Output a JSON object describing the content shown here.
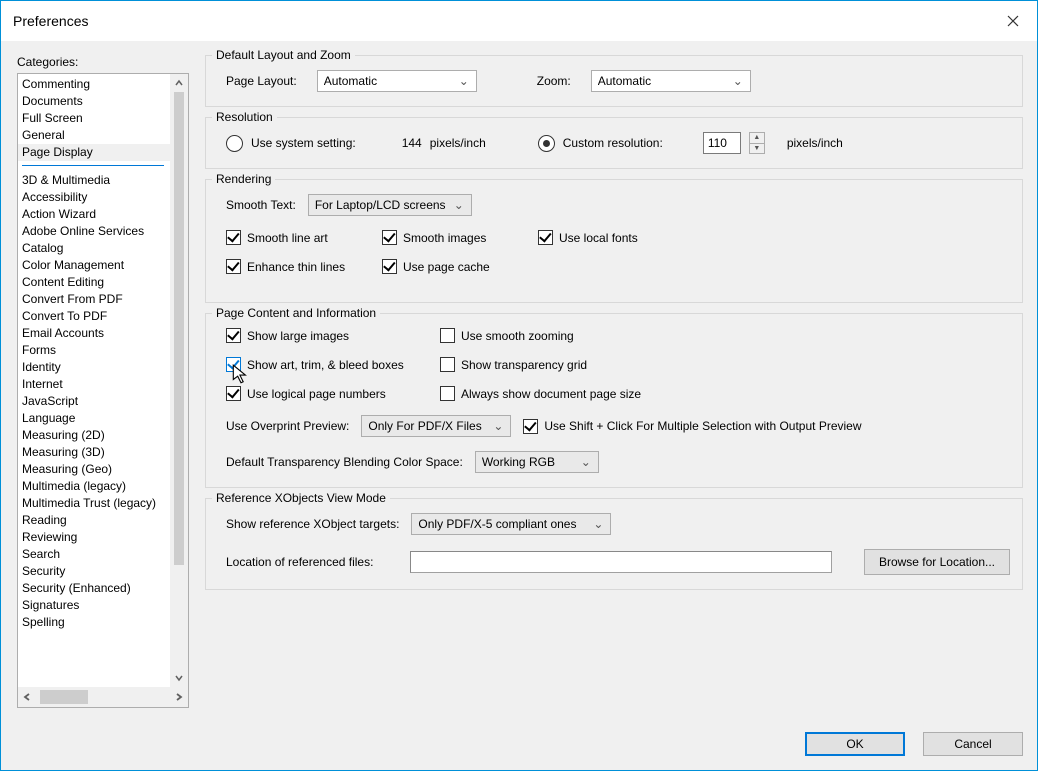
{
  "window": {
    "title": "Preferences"
  },
  "categories": {
    "label": "Categories:",
    "selected": "Page Display",
    "top_items": [
      "Commenting",
      "Documents",
      "Full Screen",
      "General",
      "Page Display"
    ],
    "bottom_items": [
      "3D & Multimedia",
      "Accessibility",
      "Action Wizard",
      "Adobe Online Services",
      "Catalog",
      "Color Management",
      "Content Editing",
      "Convert From PDF",
      "Convert To PDF",
      "Email Accounts",
      "Forms",
      "Identity",
      "Internet",
      "JavaScript",
      "Language",
      "Measuring (2D)",
      "Measuring (3D)",
      "Measuring (Geo)",
      "Multimedia (legacy)",
      "Multimedia Trust (legacy)",
      "Reading",
      "Reviewing",
      "Search",
      "Security",
      "Security (Enhanced)",
      "Signatures",
      "Spelling"
    ]
  },
  "layout_zoom": {
    "group_title": "Default Layout and Zoom",
    "page_layout_label": "Page Layout:",
    "page_layout_value": "Automatic",
    "zoom_label": "Zoom:",
    "zoom_value": "Automatic"
  },
  "resolution": {
    "group_title": "Resolution",
    "use_system_label": "Use system setting:",
    "system_value": "144",
    "system_unit": "pixels/inch",
    "custom_label": "Custom resolution:",
    "custom_value": "110",
    "custom_unit": "pixels/inch",
    "selected": "custom"
  },
  "rendering": {
    "group_title": "Rendering",
    "smooth_text_label": "Smooth Text:",
    "smooth_text_value": "For Laptop/LCD screens",
    "smooth_line_art": "Smooth line art",
    "smooth_images": "Smooth images",
    "use_local_fonts": "Use local fonts",
    "enhance_thin_lines": "Enhance thin lines",
    "use_page_cache": "Use page cache"
  },
  "page_content": {
    "group_title": "Page Content and Information",
    "show_large_images": "Show large images",
    "use_smooth_zooming": "Use smooth zooming",
    "show_art_trim_bleed": "Show art, trim, & bleed boxes",
    "show_transparency_grid": "Show transparency grid",
    "use_logical_page_numbers": "Use logical page numbers",
    "always_show_doc_page_size": "Always show document page size",
    "overprint_label": "Use Overprint Preview:",
    "overprint_value": "Only For PDF/X Files",
    "shift_click_label": "Use Shift + Click For Multiple Selection with Output Preview",
    "blending_label": "Default Transparency Blending Color Space:",
    "blending_value": "Working RGB"
  },
  "xobjects": {
    "group_title": "Reference XObjects View Mode",
    "targets_label": "Show reference XObject targets:",
    "targets_value": "Only PDF/X-5 compliant ones",
    "location_label": "Location of referenced files:",
    "browse_label": "Browse for Location..."
  },
  "footer": {
    "ok": "OK",
    "cancel": "Cancel"
  }
}
